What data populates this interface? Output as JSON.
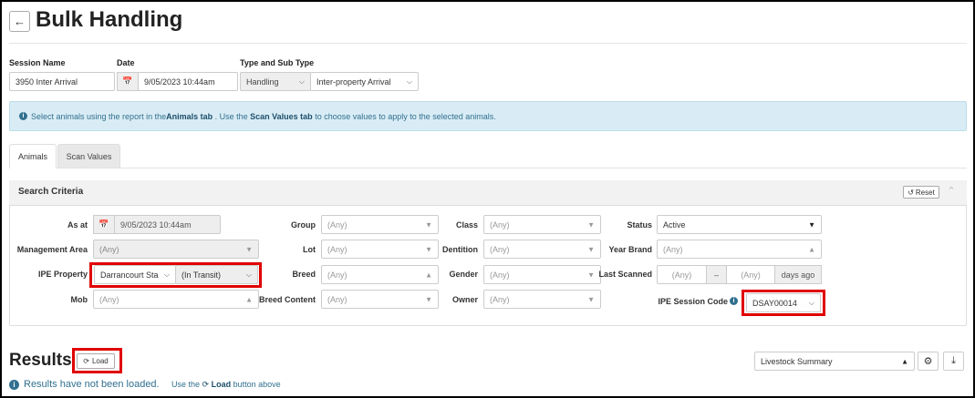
{
  "page": {
    "title": "Bulk Handling",
    "back_icon": "arrow-left-icon"
  },
  "session": {
    "name_label": "Session Name",
    "name_value": "3950 Inter Arrival",
    "date_label": "Date",
    "date_value": "9/05/2023 10:44am",
    "type_label": "Type and Sub Type",
    "type_value": "Handling",
    "subtype_value": "Inter-property Arrival"
  },
  "info": {
    "prefix": "Select animals using the report in the ",
    "animals_tab": "Animals tab",
    "middle": " . Use the ",
    "scan_tab": "Scan Values tab",
    "suffix": " to choose values to apply to the selected animals."
  },
  "tabs": [
    {
      "label": "Animals",
      "active": true
    },
    {
      "label": "Scan Values",
      "active": false
    }
  ],
  "search": {
    "title": "Search Criteria",
    "reset_label": "Reset",
    "as_at_label": "As at",
    "as_at_value": "9/05/2023 10:44am",
    "management_area_label": "Management Area",
    "management_area_value": "(Any)",
    "ipe_property_label": "IPE Property",
    "ipe_property_value": "Darrancourt Sta",
    "ipe_property_status": "(In Transit)",
    "mob_label": "Mob",
    "mob_value": "(Any)",
    "group_label": "Group",
    "group_value": "(Any)",
    "lot_label": "Lot",
    "lot_value": "(Any)",
    "breed_label": "Breed",
    "breed_value": "(Any)",
    "breed_content_label": "Breed Content",
    "breed_content_value": "(Any)",
    "class_label": "Class",
    "class_value": "(Any)",
    "dentition_label": "Dentition",
    "dentition_value": "(Any)",
    "gender_label": "Gender",
    "gender_value": "(Any)",
    "owner_label": "Owner",
    "owner_value": "(Any)",
    "status_label": "Status",
    "status_value": "Active",
    "year_brand_label": "Year Brand",
    "year_brand_value": "(Any)",
    "last_scanned_label": "Last Scanned",
    "last_scanned_from": "(Any)",
    "last_scanned_sep": "–",
    "last_scanned_to": "(Any)",
    "last_scanned_unit": "days ago",
    "ipe_session_code_label": "IPE Session Code",
    "ipe_session_code_value": "DSAY00014"
  },
  "results": {
    "title": "Results",
    "load_label": "Load",
    "not_loaded_text": "Results have not been loaded.",
    "use_prefix": "Use the",
    "use_load": "Load",
    "use_suffix": "button above",
    "report_value": "Livestock Summary"
  },
  "colors": {
    "highlight": "#e00000",
    "info_bg": "#d9ecf5",
    "info_text": "#31708f"
  }
}
